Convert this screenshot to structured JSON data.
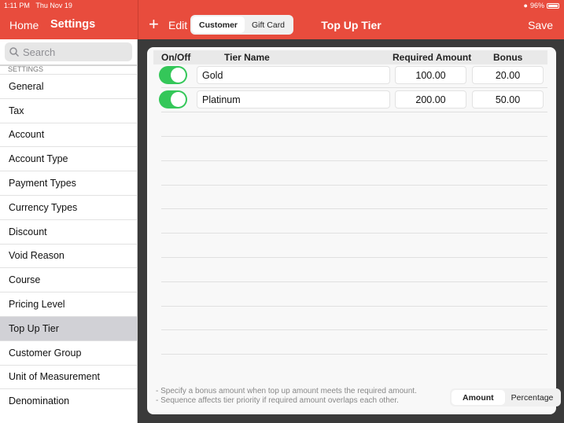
{
  "status": {
    "time": "1:11 PM",
    "date": "Thu Nov 19",
    "battery": "96%",
    "battery_level": 0.96
  },
  "nav": {
    "home": "Home",
    "settings": "Settings",
    "edit": "Edit",
    "segments": [
      "Customer",
      "Gift Card"
    ],
    "title": "Top Up Tier",
    "save": "Save"
  },
  "sidebar": {
    "search_placeholder": "Search",
    "section": "SETTINGS",
    "items": [
      "General",
      "Tax",
      "Account",
      "Account Type",
      "Payment Types",
      "Currency Types",
      "Discount",
      "Void Reason",
      "Course",
      "Pricing Level",
      "Top Up Tier",
      "Customer Group",
      "Unit of Measurement",
      "Denomination"
    ],
    "selected": "Top Up Tier"
  },
  "table": {
    "headers": [
      "On/Off",
      "Tier Name",
      "Required Amount",
      "Bonus"
    ],
    "rows": [
      {
        "on": true,
        "name": "Gold",
        "required": "100.00",
        "bonus": "20.00"
      },
      {
        "on": true,
        "name": "Platinum",
        "required": "200.00",
        "bonus": "50.00"
      }
    ]
  },
  "footer": {
    "notes": [
      "- Specify a bonus amount when top up amount meets the required amount.",
      "- Sequence affects tier priority if required amount overlaps each other."
    ],
    "segments": [
      "Amount",
      "Percentage"
    ]
  },
  "colors": {
    "accent": "#e84c3d",
    "toggle": "#34c759"
  }
}
